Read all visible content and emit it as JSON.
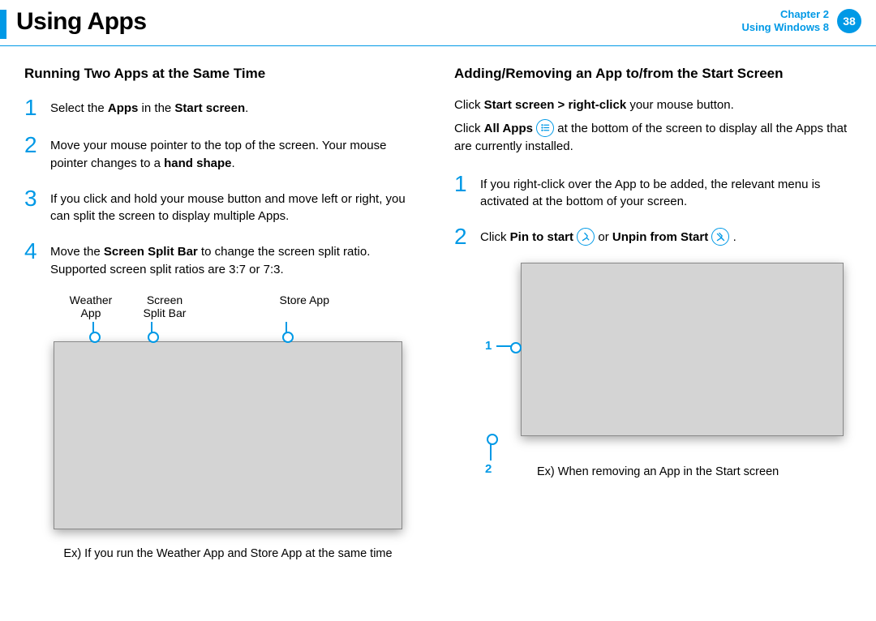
{
  "header": {
    "title": "Using Apps",
    "chapter_label": "Chapter 2",
    "section_label": "Using Windows 8",
    "page_number": "38"
  },
  "left": {
    "heading": "Running Two Apps at the Same Time",
    "steps": {
      "s1": {
        "num": "1",
        "pre": "Select the ",
        "b1": "Apps",
        "mid": " in the ",
        "b2": "Start screen",
        "post": "."
      },
      "s2": {
        "num": "2",
        "pre": " Move your mouse pointer to the top of the screen. Your mouse pointer changes to a ",
        "b1": "hand shape",
        "post": "."
      },
      "s3": {
        "num": "3",
        "text": "If you click and hold your mouse button and move left or right, you can split the screen to display multiple Apps."
      },
      "s4": {
        "num": "4",
        "pre": "Move the ",
        "b1": "Screen Split Bar",
        "post": " to change the screen split ratio. Supported screen split ratios are 3:7 or 7:3."
      }
    },
    "figure": {
      "label_weather_l1": "Weather",
      "label_weather_l2": "App",
      "label_split_l1": "Screen",
      "label_split_l2": "Split Bar",
      "label_store": "Store App",
      "caption": "Ex) If you run the Weather App and Store App at the same time"
    }
  },
  "right": {
    "heading": "Adding/Removing an App to/from the Start Screen",
    "intro": {
      "line1_pre": "Click ",
      "line1_b": "Start screen > right-click",
      "line1_post": " your mouse button.",
      "line2_pre": "Click ",
      "line2_b": "All Apps",
      "line2_post_a": " at the bottom of the screen to display all the Apps that are currently installed."
    },
    "steps": {
      "s1": {
        "num": "1",
        "text": "If you right-click over the App to be added, the relevant menu is activated at the bottom of your screen."
      },
      "s2": {
        "num": "2",
        "pre": "Click ",
        "b1": "Pin to start",
        "mid": " or ",
        "b2": "Unpin from Start",
        "post": " ."
      }
    },
    "figure": {
      "marker1": "1",
      "marker2": "2",
      "caption": "Ex) When removing an App in the Start screen"
    }
  },
  "icons": {
    "all_apps": "all-apps-icon",
    "pin": "pin-icon",
    "unpin": "unpin-icon"
  }
}
